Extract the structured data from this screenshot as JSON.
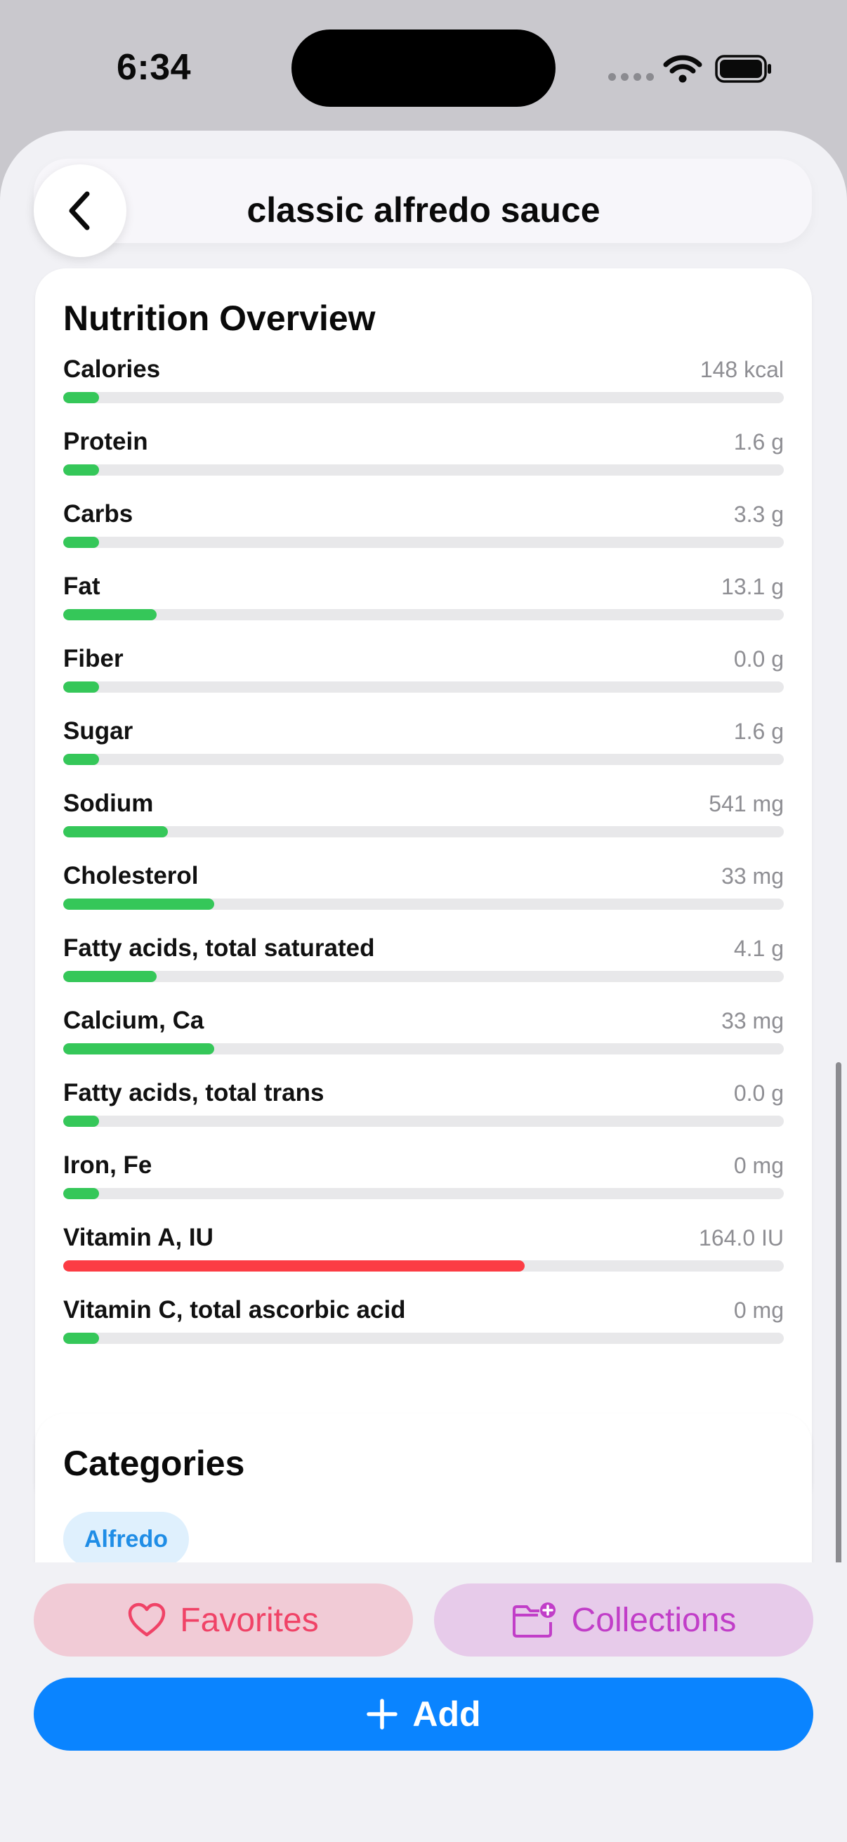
{
  "status_bar": {
    "time": "6:34"
  },
  "header": {
    "title": "classic alfredo sauce"
  },
  "nutrition": {
    "title": "Nutrition Overview",
    "items": [
      {
        "label": "Calories",
        "value": "148 kcal",
        "level": 0.05,
        "status": "ok"
      },
      {
        "label": "Protein",
        "value": "1.6 g",
        "level": 0.05,
        "status": "ok"
      },
      {
        "label": "Carbs",
        "value": "3.3 g",
        "level": 0.05,
        "status": "ok"
      },
      {
        "label": "Fat",
        "value": "13.1 g",
        "level": 0.13,
        "status": "ok"
      },
      {
        "label": "Fiber",
        "value": "0.0 g",
        "level": 0.05,
        "status": "ok"
      },
      {
        "label": "Sugar",
        "value": "1.6 g",
        "level": 0.05,
        "status": "ok"
      },
      {
        "label": "Sodium",
        "value": "541 mg",
        "level": 0.145,
        "status": "ok"
      },
      {
        "label": "Cholesterol",
        "value": "33 mg",
        "level": 0.21,
        "status": "ok"
      },
      {
        "label": "Fatty acids, total saturated",
        "value": "4.1 g",
        "level": 0.13,
        "status": "ok"
      },
      {
        "label": "Calcium, Ca",
        "value": "33 mg",
        "level": 0.21,
        "status": "ok"
      },
      {
        "label": "Fatty acids, total trans",
        "value": "0.0 g",
        "level": 0.05,
        "status": "ok"
      },
      {
        "label": "Iron, Fe",
        "value": "0 mg",
        "level": 0.05,
        "status": "ok"
      },
      {
        "label": "Vitamin A, IU",
        "value": "164.0 IU",
        "level": 0.64,
        "status": "warn"
      },
      {
        "label": "Vitamin C, total ascorbic acid",
        "value": "0 mg",
        "level": 0.05,
        "status": "ok"
      }
    ]
  },
  "categories": {
    "title": "Categories",
    "chips": [
      "Alfredo"
    ]
  },
  "actions": {
    "favorites_label": "Favorites",
    "collections_label": "Collections",
    "add_label": "Add"
  },
  "colors": {
    "ok_bar": "#35c759",
    "warn_bar": "#fc3c44",
    "add_button": "#0a84ff",
    "favorites_text": "#f04367",
    "collections_text": "#c13ec8"
  }
}
